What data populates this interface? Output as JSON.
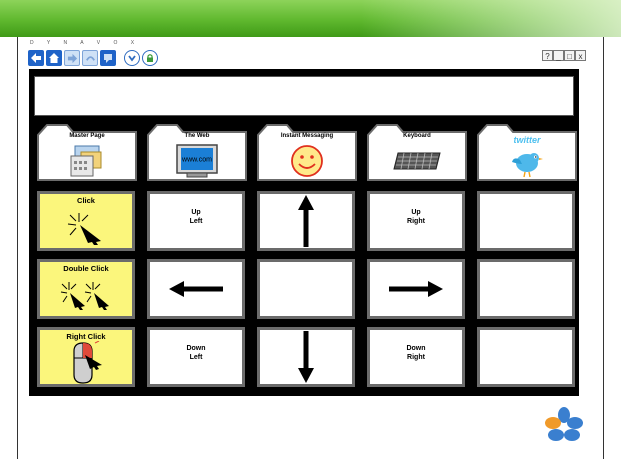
{
  "brand": "D Y N A V O X",
  "window_controls": [
    "?",
    "_",
    "□",
    "x"
  ],
  "message_text": "",
  "folders": [
    {
      "label": "Master Page",
      "icon": "calendar-icon"
    },
    {
      "label": "The Web",
      "icon": "computer-monitor-icon",
      "screen_text": "www.com"
    },
    {
      "label": "Instant Messaging",
      "icon": "smiley-face-icon"
    },
    {
      "label": "Keyboard",
      "icon": "keyboard-icon"
    },
    {
      "label": "",
      "icon": "twitter-bird-icon",
      "brand_text": "twitter"
    }
  ],
  "buttons": {
    "click": "Click",
    "up_left": "Up\nLeft",
    "up_right": "Up\nRight",
    "double_click": "Double Click",
    "right_click": "Right Click",
    "down_left": "Down\nLeft",
    "down_right": "Down\nRight"
  },
  "colors": {
    "yellow_button": "#fbf67c",
    "grid_background": "#000000",
    "toolbar_blue": "#1f63c8",
    "banner_green": "#5fb82e"
  }
}
